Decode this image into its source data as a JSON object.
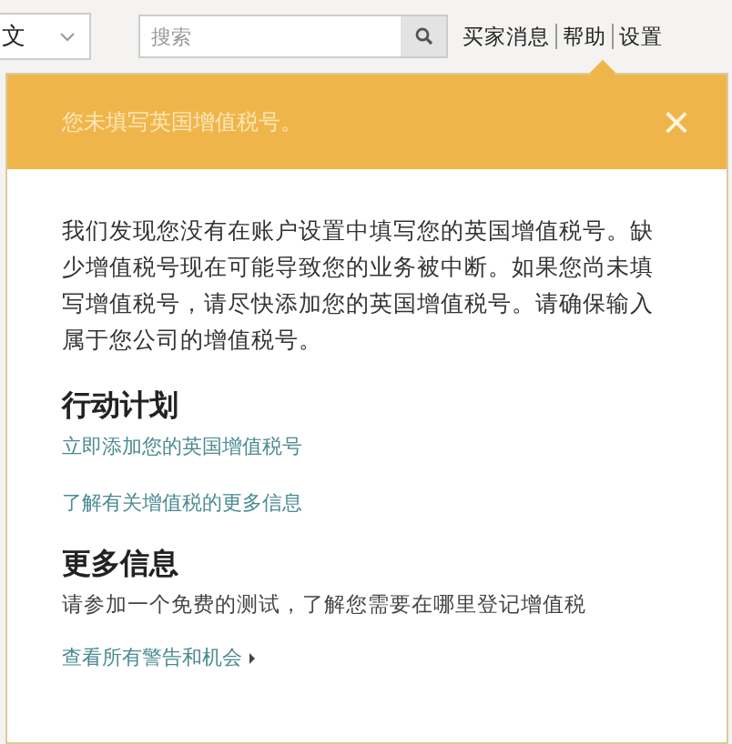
{
  "top_bar": {
    "language": "文",
    "search": {
      "placeholder": "搜索"
    },
    "links": [
      "买家消息",
      "帮助",
      "设置"
    ]
  },
  "alert": {
    "title": "您未填写英国增值税号。",
    "close": "×",
    "message": "我们发现您没有在账户设置中填写您的英国增值税号。缺少增值税号现在可能导致您的业务被中断。如果您尚未填写增值税号，请尽快添加您的英国增值税号。请确保输入属于您公司的增值税号。",
    "sections": [
      {
        "heading": "行动计划",
        "items": [
          {
            "kind": "link",
            "text": "立即添加您的英国增值税号"
          },
          {
            "kind": "link",
            "text": "了解有关增值税的更多信息"
          }
        ]
      },
      {
        "heading": "更多信息",
        "items": [
          {
            "kind": "text",
            "text": "请参加一个免费的测试，了解您需要在哪里登记增值税"
          },
          {
            "kind": "more",
            "text": "查看所有警告和机会"
          }
        ]
      }
    ]
  }
}
